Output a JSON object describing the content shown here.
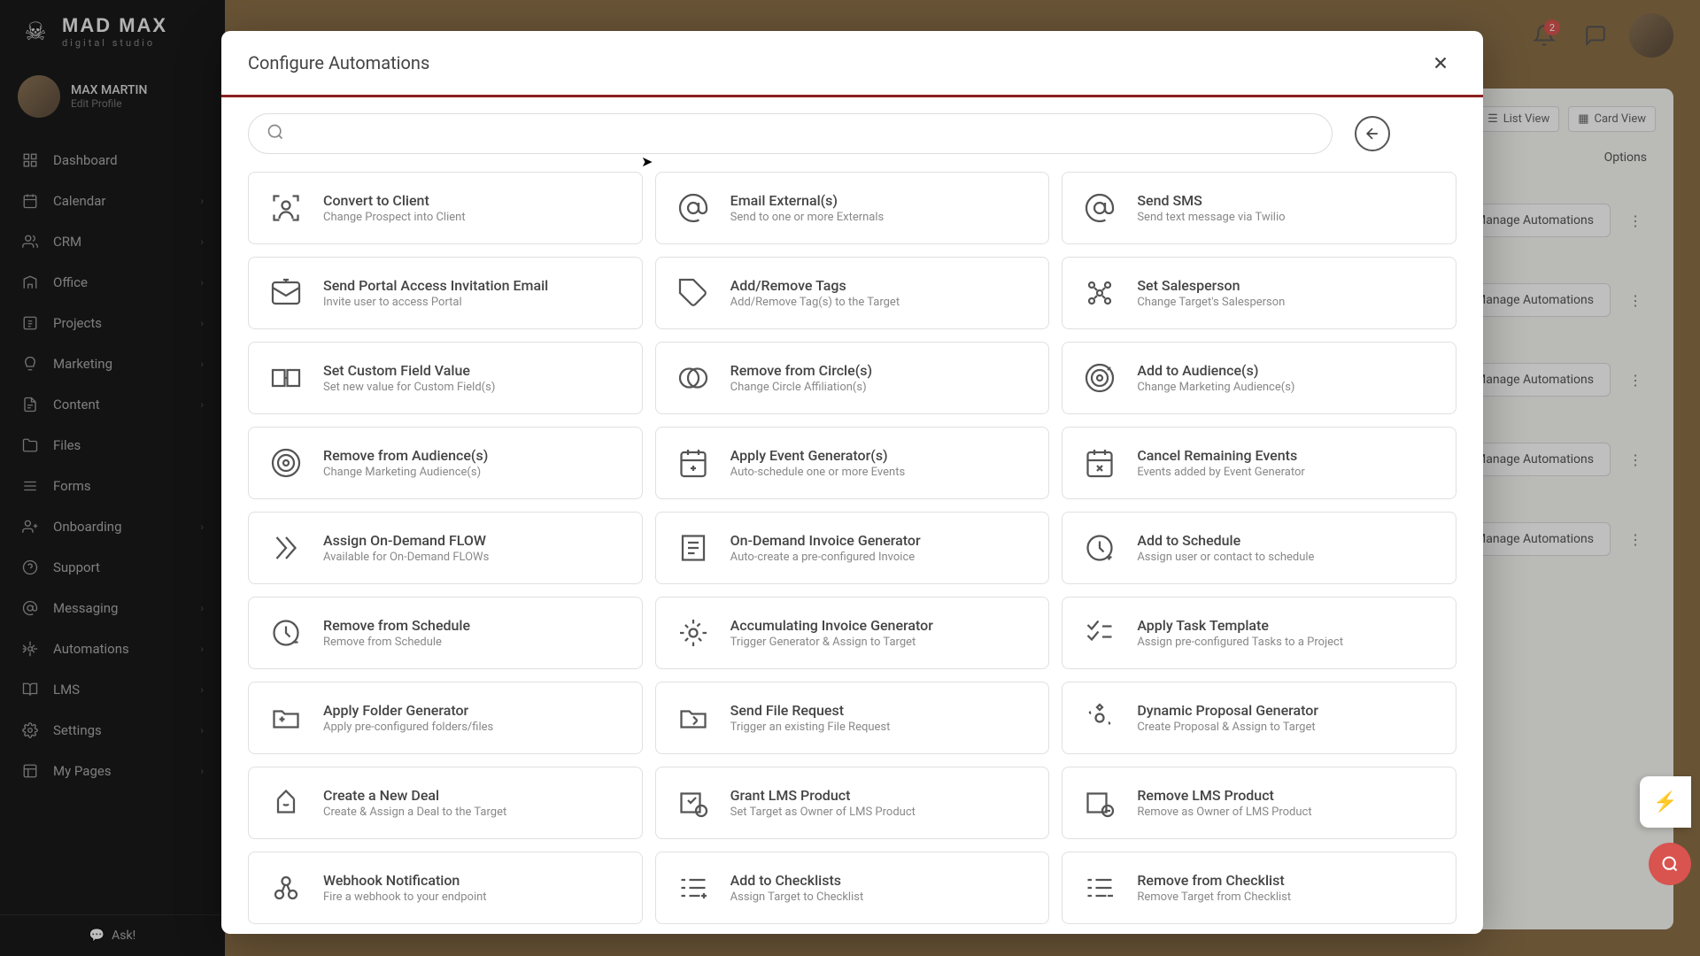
{
  "brand": {
    "main": "MAD MAX",
    "sub": "digital studio"
  },
  "user": {
    "name": "MAX MARTIN",
    "edit": "Edit Profile"
  },
  "nav": [
    {
      "label": "Dashboard",
      "icon": "dashboard"
    },
    {
      "label": "Calendar",
      "icon": "calendar",
      "sub": true
    },
    {
      "label": "CRM",
      "icon": "crm",
      "sub": true
    },
    {
      "label": "Office",
      "icon": "office",
      "sub": true
    },
    {
      "label": "Projects",
      "icon": "projects",
      "sub": true
    },
    {
      "label": "Marketing",
      "icon": "marketing",
      "sub": true
    },
    {
      "label": "Content",
      "icon": "content",
      "sub": true
    },
    {
      "label": "Files",
      "icon": "files"
    },
    {
      "label": "Forms",
      "icon": "forms"
    },
    {
      "label": "Onboarding",
      "icon": "onboarding",
      "sub": true
    },
    {
      "label": "Support",
      "icon": "support"
    },
    {
      "label": "Messaging",
      "icon": "messaging",
      "sub": true
    },
    {
      "label": "Automations",
      "icon": "automations",
      "sub": true
    },
    {
      "label": "LMS",
      "icon": "lms",
      "sub": true
    },
    {
      "label": "Settings",
      "icon": "settings",
      "sub": true
    },
    {
      "label": "My Pages",
      "icon": "pages",
      "sub": true
    }
  ],
  "ask": "Ask!",
  "topbar": {
    "notifications": "2"
  },
  "views": {
    "list": "List View",
    "card": "Card View"
  },
  "options": "Options",
  "manage": "Manage Automations",
  "modal": {
    "title": "Configure Automations",
    "actions": [
      {
        "t": "Convert to Client",
        "s": "Change Prospect into Client",
        "i": "convert"
      },
      {
        "t": "Email External(s)",
        "s": "Send to one or more Externals",
        "i": "email"
      },
      {
        "t": "Send SMS",
        "s": "Send text message via Twilio",
        "i": "sms"
      },
      {
        "t": "Send Portal Access Invitation Email",
        "s": "Invite user to access Portal",
        "i": "portal"
      },
      {
        "t": "Add/Remove Tags",
        "s": "Add/Remove Tag(s) to the Target",
        "i": "tags"
      },
      {
        "t": "Set Salesperson",
        "s": "Change Target's Salesperson",
        "i": "salesperson"
      },
      {
        "t": "Set Custom Field Value",
        "s": "Set new value for Custom Field(s)",
        "i": "field"
      },
      {
        "t": "Remove from Circle(s)",
        "s": "Change Circle Affiliation(s)",
        "i": "circle"
      },
      {
        "t": "Add to Audience(s)",
        "s": "Change Marketing Audience(s)",
        "i": "audience-add"
      },
      {
        "t": "Remove from Audience(s)",
        "s": "Change Marketing Audience(s)",
        "i": "audience-rm"
      },
      {
        "t": "Apply Event Generator(s)",
        "s": "Auto-schedule one or more Events",
        "i": "event-gen"
      },
      {
        "t": "Cancel Remaining Events",
        "s": "Events added by Event Generator",
        "i": "event-cancel"
      },
      {
        "t": "Assign On-Demand FLOW",
        "s": "Available for On-Demand FLOWs",
        "i": "flow"
      },
      {
        "t": "On-Demand Invoice Generator",
        "s": "Auto-create a pre-configured Invoice",
        "i": "invoice"
      },
      {
        "t": "Add to Schedule",
        "s": "Assign user or contact to schedule",
        "i": "schedule-add"
      },
      {
        "t": "Remove from Schedule",
        "s": "Remove from Schedule",
        "i": "schedule-rm"
      },
      {
        "t": "Accumulating Invoice Generator",
        "s": "Trigger Generator & Assign to Target",
        "i": "acc-invoice"
      },
      {
        "t": "Apply Task Template",
        "s": "Assign pre-configured Tasks to a Project",
        "i": "tasks"
      },
      {
        "t": "Apply Folder Generator",
        "s": "Apply pre-configured folders/files",
        "i": "folder"
      },
      {
        "t": "Send File Request",
        "s": "Trigger an existing File Request",
        "i": "file-req"
      },
      {
        "t": "Dynamic Proposal Generator",
        "s": "Create Proposal & Assign to Target",
        "i": "proposal"
      },
      {
        "t": "Create a New Deal",
        "s": "Create & Assign a Deal to the Target",
        "i": "deal"
      },
      {
        "t": "Grant LMS Product",
        "s": "Set Target as Owner of LMS Product",
        "i": "lms-grant"
      },
      {
        "t": "Remove LMS Product",
        "s": "Remove as Owner of LMS Product",
        "i": "lms-rm"
      },
      {
        "t": "Webhook Notification",
        "s": "Fire a webhook to your endpoint",
        "i": "webhook"
      },
      {
        "t": "Add to Checklists",
        "s": "Assign Target to Checklist",
        "i": "checklist-add"
      },
      {
        "t": "Remove from Checklist",
        "s": "Remove Target from Checklist",
        "i": "checklist-rm"
      }
    ]
  }
}
